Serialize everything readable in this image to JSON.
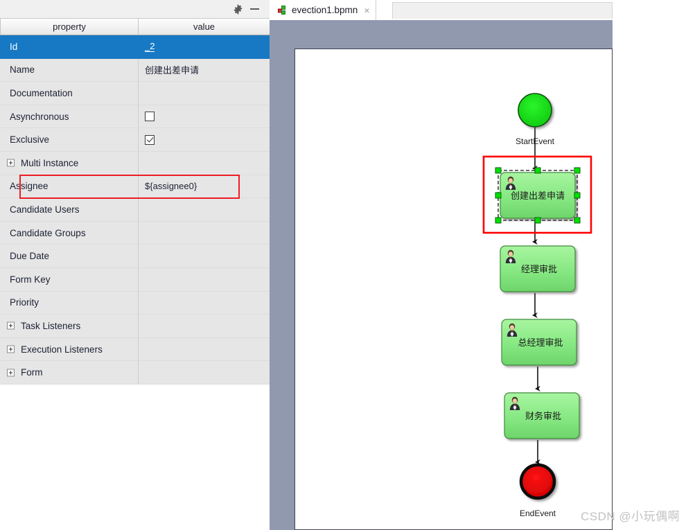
{
  "properties_panel": {
    "toolbar": {
      "settings_icon": "gear-icon",
      "minimize_icon": "minimize-icon"
    },
    "columns": {
      "property": "property",
      "value": "value"
    },
    "rows": [
      {
        "name": "Id",
        "value": "_2",
        "type": "text",
        "selected": true,
        "expandable": false
      },
      {
        "name": "Name",
        "value": "创建出差申请",
        "type": "text",
        "selected": false,
        "expandable": false
      },
      {
        "name": "Documentation",
        "value": "",
        "type": "text",
        "selected": false,
        "expandable": false
      },
      {
        "name": "Asynchronous",
        "value": "",
        "type": "checkbox",
        "checked": false,
        "selected": false,
        "expandable": false
      },
      {
        "name": "Exclusive",
        "value": "",
        "type": "checkbox",
        "checked": true,
        "selected": false,
        "expandable": false
      },
      {
        "name": "Multi Instance",
        "value": "",
        "type": "text",
        "selected": false,
        "expandable": true
      },
      {
        "name": "Assignee",
        "value": "${assignee0}",
        "type": "text",
        "selected": false,
        "expandable": false,
        "highlighted": true
      },
      {
        "name": "Candidate Users",
        "value": "",
        "type": "text",
        "selected": false,
        "expandable": false
      },
      {
        "name": "Candidate Groups",
        "value": "",
        "type": "text",
        "selected": false,
        "expandable": false
      },
      {
        "name": "Due Date",
        "value": "",
        "type": "text",
        "selected": false,
        "expandable": false
      },
      {
        "name": "Form Key",
        "value": "",
        "type": "text",
        "selected": false,
        "expandable": false
      },
      {
        "name": "Priority",
        "value": "",
        "type": "text",
        "selected": false,
        "expandable": false
      },
      {
        "name": "Task Listeners",
        "value": "",
        "type": "text",
        "selected": false,
        "expandable": true
      },
      {
        "name": "Execution Listeners",
        "value": "",
        "type": "text",
        "selected": false,
        "expandable": true
      },
      {
        "name": "Form",
        "value": "",
        "type": "text",
        "selected": false,
        "expandable": true
      }
    ],
    "colors": {
      "selection": "#1779c4",
      "row_background": "#e6e6e6",
      "highlight_box": "#ed1c24"
    }
  },
  "editor": {
    "tab": {
      "label": "evection1.bpmn",
      "close_label": "×",
      "icon": "bpmn-file-icon"
    },
    "canvas_background": "#9099ae"
  },
  "diagram": {
    "nodes": [
      {
        "id": "startevent",
        "type": "start-event",
        "label": "StartEvent",
        "label_position": "below",
        "fill": "#22dd22"
      },
      {
        "id": "task1",
        "type": "user-task",
        "label": "创建出差申请",
        "label_position": "inside",
        "fill": "#90ee90",
        "selected": true
      },
      {
        "id": "task2",
        "type": "user-task",
        "label": "经理审批",
        "label_position": "inside",
        "fill": "#90ee90",
        "selected": false
      },
      {
        "id": "task3",
        "type": "user-task",
        "label": "总经理审批",
        "label_position": "inside",
        "fill": "#90ee90",
        "selected": false
      },
      {
        "id": "task4",
        "type": "user-task",
        "label": "财务审批",
        "label_position": "inside",
        "fill": "#90ee90",
        "selected": false
      },
      {
        "id": "endevent",
        "type": "end-event",
        "label": "EndEvent",
        "label_position": "below",
        "fill": "#ee0000"
      }
    ],
    "flows": [
      {
        "from": "startevent",
        "to": "task1"
      },
      {
        "from": "task1",
        "to": "task2"
      },
      {
        "from": "task2",
        "to": "task3"
      },
      {
        "from": "task3",
        "to": "task4"
      },
      {
        "from": "task4",
        "to": "endevent"
      }
    ],
    "selection_color": "#ff0000",
    "handle_color": "#00e000"
  },
  "watermark": {
    "text": "CSDN @小玩偶啊"
  }
}
